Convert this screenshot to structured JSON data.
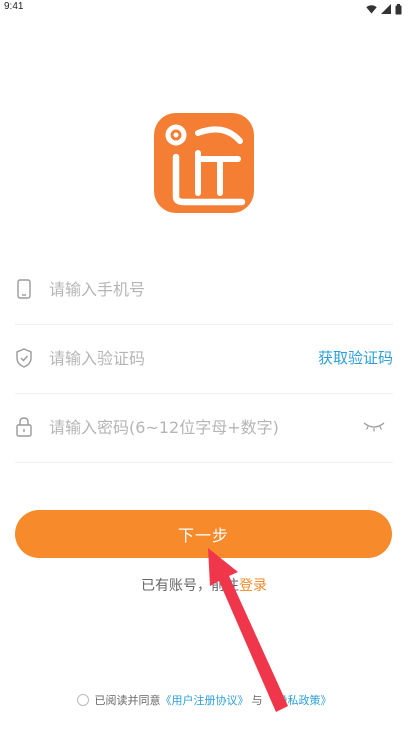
{
  "status_bar": {
    "time": "9:41",
    "icons": [
      "wifi-icon",
      "signal-icon",
      "battery-icon"
    ]
  },
  "logo": {
    "icon": "app-logo-icon",
    "color": "#f47f34"
  },
  "form": {
    "phone": {
      "icon": "phone-icon",
      "placeholder": "请输入手机号",
      "value": ""
    },
    "code": {
      "icon": "shield-icon",
      "placeholder": "请输入验证码",
      "value": "",
      "get_code_label": "获取验证码"
    },
    "password": {
      "icon": "lock-icon",
      "placeholder": "请输入密码(6~12位字母+数字)",
      "value": "",
      "toggle_icon": "eye-closed-icon"
    }
  },
  "actions": {
    "next_label": "下一步",
    "have_account_text": "已有账号，前往",
    "login_label": "登录"
  },
  "agreement": {
    "prefix": "已阅读并同意",
    "user_agreement": "《用户注册协议》",
    "conjunction": "与",
    "privacy_policy": "《隐私政策》",
    "checked": false
  },
  "colors": {
    "accent": "#f78a2a",
    "link": "#2d9fd8",
    "annotation_arrow": "#f0364a"
  }
}
